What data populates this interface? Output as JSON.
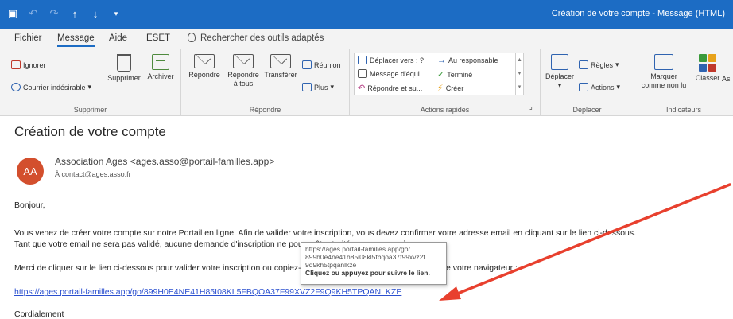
{
  "window": {
    "title": "Création de votre compte  -  Message (HTML)"
  },
  "qat": {
    "save_icon": "save-icon",
    "undo_icon": "undo-icon",
    "redo_icon": "redo-icon",
    "up_icon": "up-arrow-icon",
    "down_icon": "down-arrow-icon"
  },
  "tabs": [
    {
      "label": "Fichier"
    },
    {
      "label": "Message"
    },
    {
      "label": "Aide"
    },
    {
      "label": "ESET"
    }
  ],
  "tell_me": {
    "label": "Rechercher des outils adaptés"
  },
  "ribbon": {
    "delete_group": {
      "label": "Supprimer",
      "ignore": "Ignorer",
      "junk": "Courrier indésirable",
      "delete": "Supprimer",
      "archive": "Archiver"
    },
    "respond_group": {
      "label": "Répondre",
      "reply": "Répondre",
      "reply_all_1": "Répondre",
      "reply_all_2": "à tous",
      "forward": "Transférer",
      "meeting": "Réunion",
      "more": "Plus"
    },
    "quick_steps": {
      "label": "Actions rapides",
      "move_to": "Déplacer vers : ?",
      "team_message": "Message d'équi...",
      "reply_delete": "Répondre et su...",
      "to_manager": "Au responsable",
      "done": "Terminé",
      "create": "Créer"
    },
    "move_group": {
      "label": "Déplacer",
      "move": "Déplacer",
      "rules": "Règles",
      "actions": "Actions"
    },
    "tags_group": {
      "label": "Indicateurs",
      "mark_unread_1": "Marquer",
      "mark_unread_2": "comme non lu",
      "categorize": "Classer",
      "assign_partial": "As"
    }
  },
  "message": {
    "subject": "Création de votre compte",
    "avatar_initials": "AA",
    "sender": "Association Ages <ages.asso@portail-familles.app>",
    "to": "À   contact@ages.asso.fr",
    "greeting": "Bonjour,",
    "para1": "Vous venez de créer votre compte sur notre Portail en ligne. Afin de valider votre inscription, vous devez confirmer votre adresse email en cliquant sur le lien ci-dessous.",
    "para2": "Tant que votre email ne sera pas validé, aucune demande d'inscription ne pourra être traitée par nos services.",
    "para3": "Merci de cliquer sur le lien ci-dessous pour valider votre inscription ou copiez-le et collez-le dans la barre d'adresse de votre navigateur :",
    "link": "https://ages.portail-familles.app/go/899H0E4NE41H85I08KL5FBQOA37F99XVZ2F9Q9KH5TPQANLKZE",
    "closing": "Cordialement",
    "tooltip": {
      "line1": "https://ages.portail-familles.app/go/",
      "line2": "899h0e4ne41h85i08kl5fbqoa37f99xvz2f",
      "line3": "9q9kh5tpqanlkze",
      "hint": "Cliquez ou appuyez pour suivre le lien."
    }
  },
  "colors": {
    "titlebar": "#1c6cc4",
    "avatar": "#d34f2d",
    "link": "#2a4fcf",
    "annotation_arrow": "#e8402e"
  }
}
